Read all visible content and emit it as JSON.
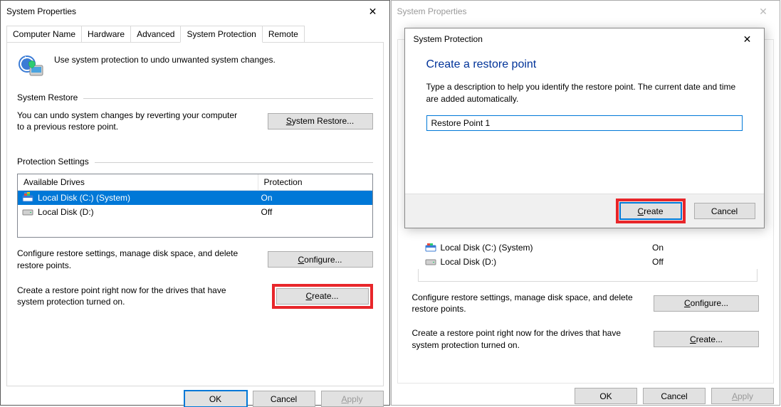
{
  "left": {
    "title": "System Properties",
    "tabs": [
      "Computer Name",
      "Hardware",
      "Advanced",
      "System Protection",
      "Remote"
    ],
    "intro": "Use system protection to undo unwanted system changes.",
    "group_restore": "System Restore",
    "restore_text": "You can undo system changes by reverting your computer to a previous restore point.",
    "restore_btn_prefix": "S",
    "restore_btn_rest": "ystem Restore...",
    "group_protect": "Protection Settings",
    "list": {
      "col_drives": "Available Drives",
      "col_prot": "Protection",
      "rows": [
        {
          "name": "Local Disk (C:) (System)",
          "prot": "On",
          "sel": true
        },
        {
          "name": "Local Disk (D:)",
          "prot": "Off",
          "sel": false
        }
      ]
    },
    "cfg_text": "Configure restore settings, manage disk space, and delete restore points.",
    "cfg_btn_prefix": "C",
    "cfg_btn_rest": "onfigure...",
    "create_text": "Create a restore point right now for the drives that have system protection turned on.",
    "create_btn_prefix": "C",
    "create_btn_rest": "reate...",
    "footer": {
      "ok": "OK",
      "cancel": "Cancel",
      "apply_prefix": "A",
      "apply_rest": "pply"
    }
  },
  "right": {
    "title": "System Properties",
    "modal": {
      "title": "System Protection",
      "heading": "Create a restore point",
      "text": "Type a description to help you identify the restore point. The current date and time are added automatically.",
      "input_value": "Restore Point 1",
      "create_prefix": "C",
      "create_rest": "reate",
      "cancel": "Cancel"
    },
    "list": {
      "rows": [
        {
          "name": "Local Disk (C:) (System)",
          "prot": "On"
        },
        {
          "name": "Local Disk (D:)",
          "prot": "Off"
        }
      ]
    },
    "cfg_text": "Configure restore settings, manage disk space, and delete restore points.",
    "cfg_btn_prefix": "C",
    "cfg_btn_rest": "onfigure...",
    "create_text": "Create a restore point right now for the drives that have system protection turned on.",
    "create_btn_prefix": "C",
    "create_btn_rest": "reate...",
    "footer": {
      "ok": "OK",
      "cancel": "Cancel",
      "apply_prefix": "A",
      "apply_rest": "pply"
    }
  }
}
